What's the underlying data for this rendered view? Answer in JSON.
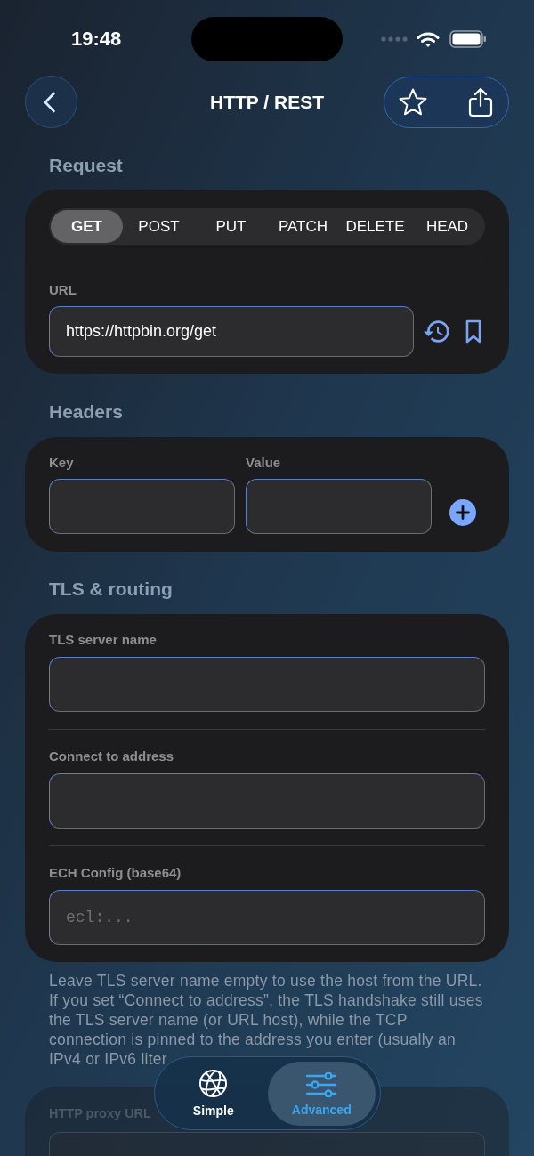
{
  "status_bar": {
    "time": "19:48"
  },
  "nav": {
    "title": "HTTP / REST"
  },
  "request": {
    "title": "Request",
    "methods": [
      {
        "label": "GET",
        "selected": true
      },
      {
        "label": "POST",
        "selected": false
      },
      {
        "label": "PUT",
        "selected": false
      },
      {
        "label": "PATCH",
        "selected": false
      },
      {
        "label": "DELETE",
        "selected": false
      },
      {
        "label": "HEAD",
        "selected": false
      }
    ],
    "url": {
      "label": "URL",
      "value": "https://httpbin.org/get"
    }
  },
  "headers": {
    "title": "Headers",
    "columns": [
      {
        "label": "Key"
      },
      {
        "label": "Value"
      }
    ]
  },
  "tls_routing": {
    "title": "TLS & routing",
    "fields": [
      {
        "label": "TLS server name"
      },
      {
        "label": "Connect to address"
      },
      {
        "label": "ECH Config (base64)",
        "placeholder": "ecl:..."
      }
    ],
    "note": "Leave TLS server name empty to use the host from the URL. If you set “Connect to address”, the TLS handshake still uses the TLS server name (or URL host), while the TCP connection is pinned to the address you enter (usually an IPv4 or IPv6 liter"
  },
  "proxy": {
    "fields": [
      {
        "label": "HTTP proxy URL"
      }
    ]
  },
  "tab_bar": {
    "tabs": [
      {
        "label": "Simple",
        "selected": false
      },
      {
        "label": "Advanced",
        "selected": true
      }
    ]
  }
}
